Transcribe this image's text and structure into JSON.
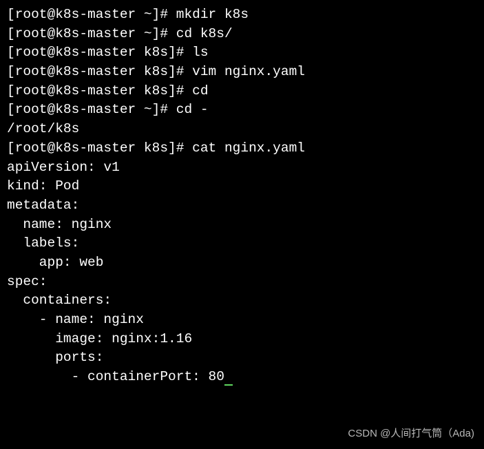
{
  "terminal": {
    "lines": [
      {
        "prompt": "[root@k8s-master ~]# ",
        "command": "mkdir k8s"
      },
      {
        "prompt": "[root@k8s-master ~]# ",
        "command": "cd k8s/"
      },
      {
        "prompt": "[root@k8s-master k8s]# ",
        "command": "ls"
      },
      {
        "prompt": "[root@k8s-master k8s]# ",
        "command": "vim nginx.yaml"
      },
      {
        "prompt": "[root@k8s-master k8s]# ",
        "command": "cd"
      },
      {
        "prompt": "[root@k8s-master ~]# ",
        "command": "cd -"
      },
      {
        "output": "/root/k8s"
      },
      {
        "prompt": "[root@k8s-master k8s]# ",
        "command": "cat nginx.yaml"
      },
      {
        "output": "apiVersion: v1"
      },
      {
        "output": "kind: Pod"
      },
      {
        "output": "metadata:"
      },
      {
        "output": "  name: nginx"
      },
      {
        "output": "  labels:"
      },
      {
        "output": "    app: web"
      },
      {
        "output": "spec:"
      },
      {
        "output": "  containers:"
      },
      {
        "output": "    - name: nginx"
      },
      {
        "output": "      image: nginx:1.16"
      },
      {
        "output": "      ports:"
      },
      {
        "output": "        - containerPort: 80",
        "cursor_after": true
      }
    ]
  },
  "watermark": "CSDN @人间打气筒（Ada)"
}
